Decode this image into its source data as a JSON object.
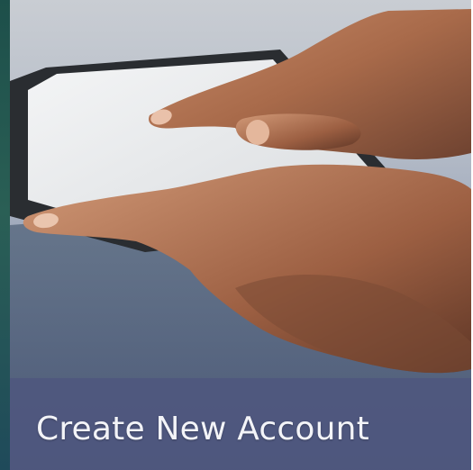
{
  "tile": {
    "label": "Create New Account"
  }
}
